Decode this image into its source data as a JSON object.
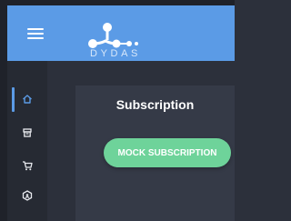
{
  "brand": {
    "name": "DYDAS"
  },
  "colors": {
    "accent": "#5b9be6",
    "button": "#6ed39a",
    "card": "#353a47",
    "background": "#2c303b"
  },
  "sidebar": {
    "items": [
      {
        "icon": "home-icon",
        "active": true
      },
      {
        "icon": "archive-icon",
        "active": false
      },
      {
        "icon": "cart-icon",
        "active": false
      },
      {
        "icon": "badge-icon",
        "active": false
      }
    ]
  },
  "main": {
    "card": {
      "title": "Subscription",
      "button_label": "MOCK SUBSCRIPTION"
    }
  }
}
